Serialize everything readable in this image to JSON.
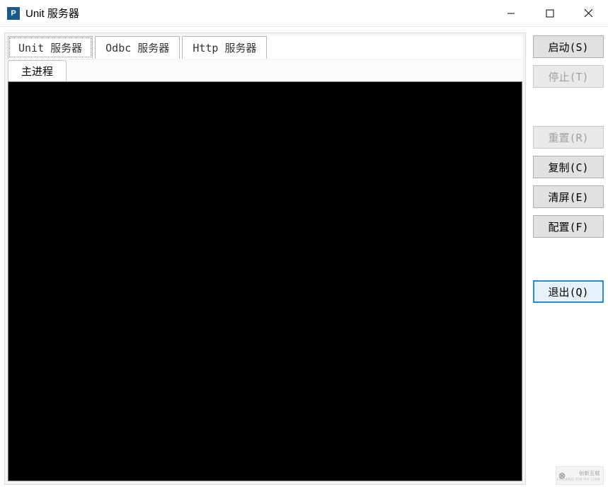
{
  "window": {
    "title": "Unit 服务器"
  },
  "tabs": {
    "top": [
      {
        "label": "Unit 服务器",
        "active": true
      },
      {
        "label": "Odbc 服务器",
        "active": false
      },
      {
        "label": "Http 服务器",
        "active": false
      }
    ],
    "sub": [
      {
        "label": "主进程",
        "active": true
      }
    ]
  },
  "buttons": {
    "start": {
      "label": "启动(S)",
      "enabled": true
    },
    "stop": {
      "label": "停止(T)",
      "enabled": false
    },
    "reset": {
      "label": "重置(R)",
      "enabled": false
    },
    "copy": {
      "label": "复制(C)",
      "enabled": true
    },
    "clear": {
      "label": "清屏(E)",
      "enabled": true
    },
    "config": {
      "label": "配置(F)",
      "enabled": true
    },
    "exit": {
      "label": "退出(Q)",
      "enabled": true,
      "highlighted": true
    }
  },
  "watermark": {
    "logo": "⊗",
    "text": "创新互联",
    "sub": "CHUANG XIN HU LIAN"
  }
}
